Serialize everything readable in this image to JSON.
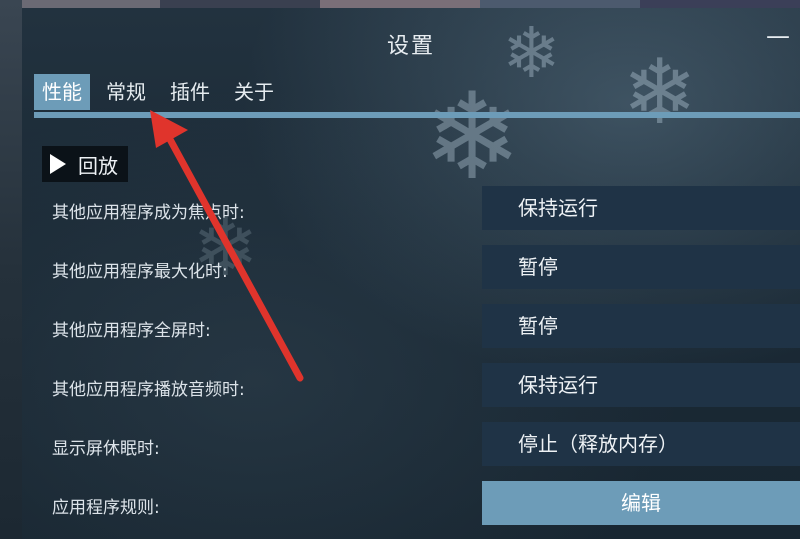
{
  "title": "设置",
  "tabs": [
    {
      "label": "性能",
      "active": true
    },
    {
      "label": "常规"
    },
    {
      "label": "插件"
    },
    {
      "label": "关于"
    }
  ],
  "section": {
    "label": "回放"
  },
  "settings": [
    {
      "label": "其他应用程序成为焦点时:",
      "value": "保持运行"
    },
    {
      "label": "其他应用程序最大化时:",
      "value": "暂停"
    },
    {
      "label": "其他应用程序全屏时:",
      "value": "暂停"
    },
    {
      "label": "其他应用程序播放音频时:",
      "value": "保持运行"
    },
    {
      "label": "显示屏休眠时:",
      "value": "停止（释放内存）"
    },
    {
      "label": "应用程序规则:",
      "value": "编辑"
    }
  ],
  "colors": {
    "accent": "#6d9cb8",
    "value_bg": "#1f3346",
    "arrow": "#e0342c"
  }
}
